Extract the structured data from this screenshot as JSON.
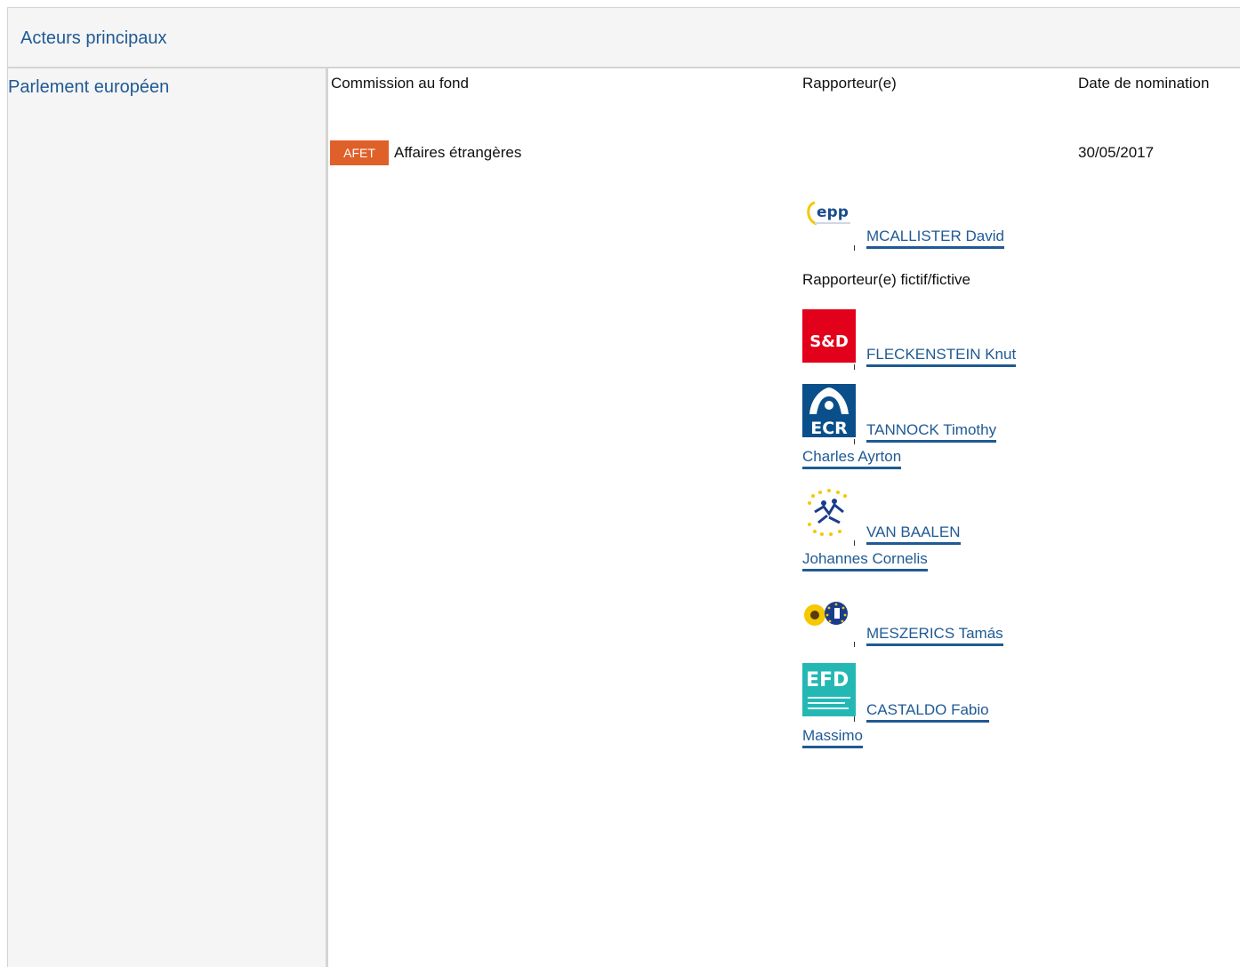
{
  "header": {
    "title": "Acteurs principaux"
  },
  "institution": "Parlement européen",
  "columns": {
    "committee": "Commission au fond",
    "rapporteur": "Rapporteur(e)",
    "date": "Date de nomination"
  },
  "committee": {
    "code": "AFET",
    "name": "Affaires étrangères",
    "date": "30/05/2017",
    "badge_color": "#e0602a"
  },
  "rapporteur": {
    "name": "MCALLISTER David",
    "group_logo": "epp-logo"
  },
  "shadow_label": "Rapporteur(e) fictif/fictive",
  "shadows": [
    {
      "name": "FLECKENSTEIN Knut",
      "group_logo": "sd-logo"
    },
    {
      "name_line1": "TANNOCK Timothy",
      "name_line2": "Charles Ayrton",
      "group_logo": "ecr-logo"
    },
    {
      "name_line1": "VAN BAALEN",
      "name_line2": "Johannes Cornelis",
      "group_logo": "alde-logo"
    },
    {
      "name": "MESZERICS Tamás",
      "group_logo": "greens-efa-logo"
    },
    {
      "name_line1": "CASTALDO Fabio",
      "name_line2": "Massimo",
      "group_logo": "efdd-logo"
    }
  ],
  "logo_text": {
    "epp": "epp",
    "sd": "S&D",
    "ecr": "ECR",
    "efdd": "EFD"
  },
  "link_color": "#1f5a94"
}
